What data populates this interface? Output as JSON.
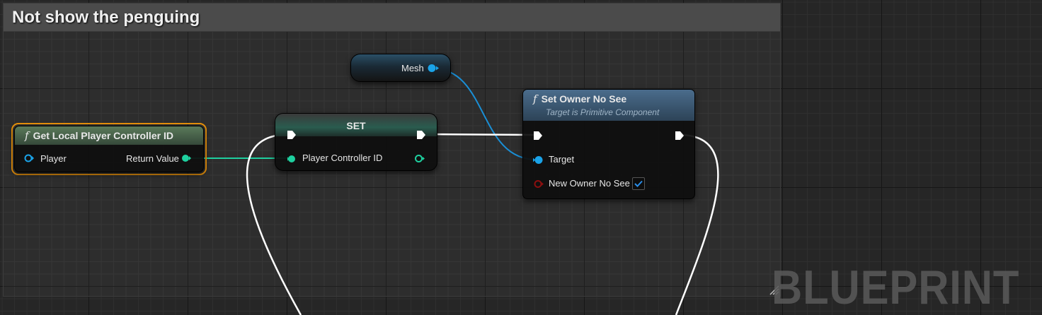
{
  "comment": {
    "title": "Not show the penguing"
  },
  "nodes": {
    "get_local_player_controller_id": {
      "title": "Get Local Player Controller ID",
      "pins": {
        "player": "Player",
        "return_value": "Return Value"
      },
      "header_color": "#4f6e50",
      "selected_outline_color": "#e8920c"
    },
    "set": {
      "title": "SET",
      "pins": {
        "player_controller_id": "Player Controller ID"
      },
      "header_color": "#2a5c4f"
    },
    "mesh": {
      "label": "Mesh"
    },
    "set_owner_no_see": {
      "title": "Set Owner No See",
      "subtitle": "Target is Primitive Component",
      "pins": {
        "target": "Target",
        "new_owner_no_see": "New Owner No See"
      },
      "new_owner_no_see_checked": true,
      "header_color": "#3f5f7e"
    }
  },
  "pin_colors": {
    "object": "#1aa3e8",
    "integer": "#1ed09f",
    "boolean": "#8c0f0f",
    "exec": "#ffffff"
  },
  "watermark": "BLUEPRINT"
}
